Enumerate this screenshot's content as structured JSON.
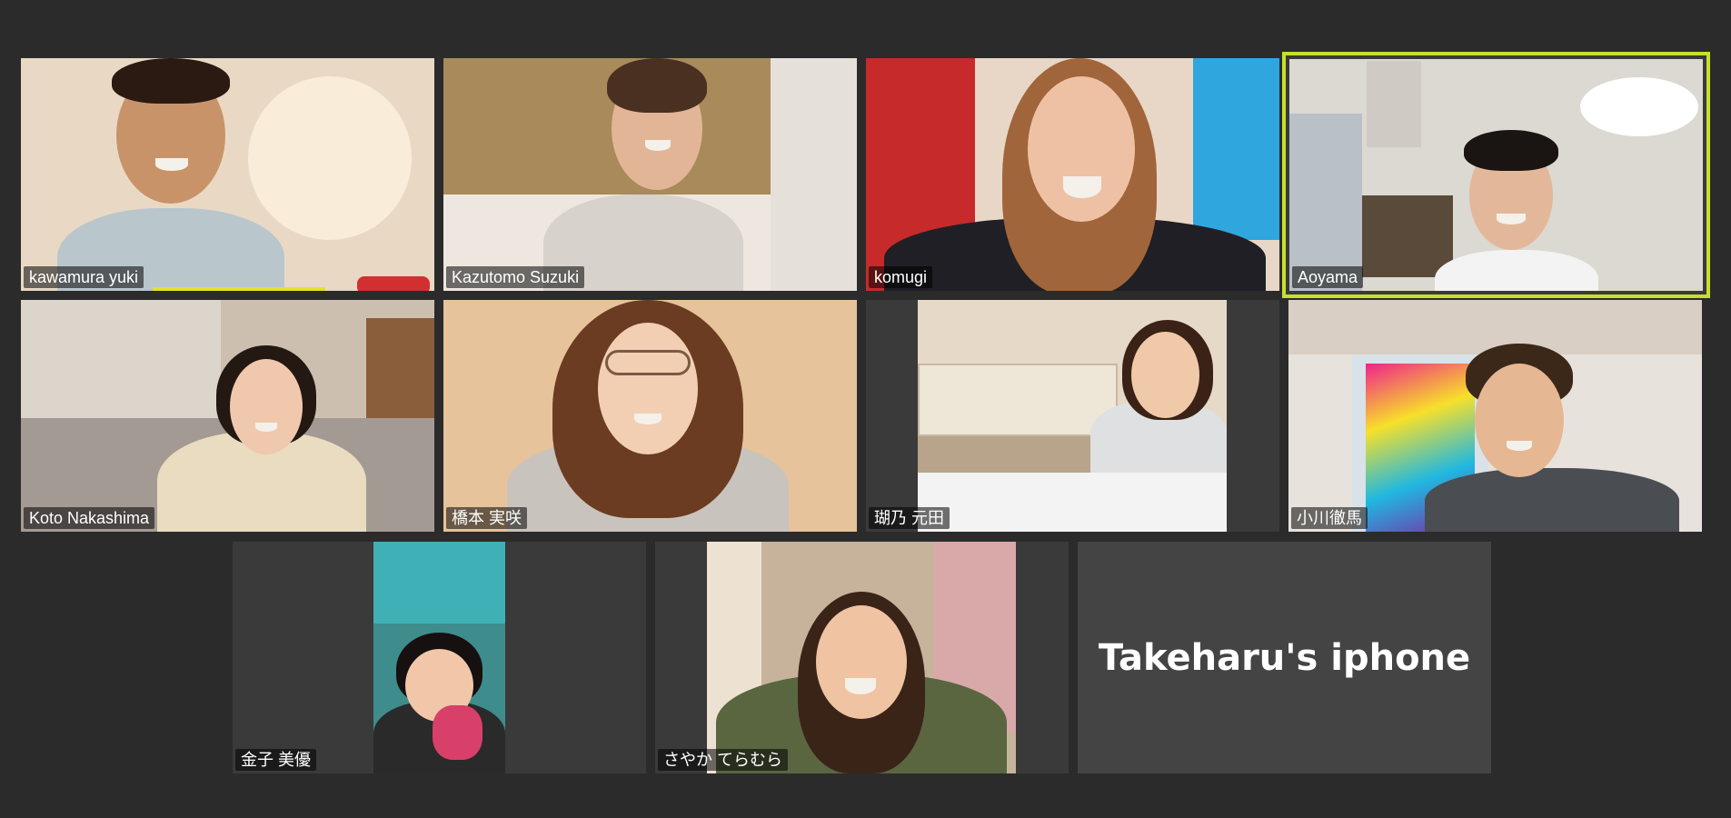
{
  "participants": [
    {
      "name": "kawamura yuki",
      "bg": "#e9d9c4",
      "skin": "#c9936a",
      "hair": "#2a1a12",
      "shirt": "#b9c6cc"
    },
    {
      "name": "Kazutomo Suzuki",
      "bg": "#a98a5a",
      "skin": "#e2b596",
      "hair": "#4a3020",
      "shirt": "#d8d2cc"
    },
    {
      "name": "komugi",
      "bg": "#c72a2a",
      "skin": "#efc1a4",
      "hair": "#a0653a",
      "shirt": "#1f1f25"
    },
    {
      "name": "Aoyama",
      "bg": "#dcd8d2",
      "skin": "#e3b89a",
      "hair": "#1a1412",
      "shirt": "#f3f3f3"
    },
    {
      "name": "Koto Nakashima",
      "bg": "#cdbfb0",
      "skin": "#f0c8ae",
      "hair": "#241812",
      "shirt": "#e9dcc0"
    },
    {
      "name": "橋本 実咲",
      "bg": "#e6c39a",
      "skin": "#f2cfb3",
      "hair": "#6b3c22",
      "shirt": "#c9c3bd"
    },
    {
      "name": "瑚乃 元田",
      "bg": "#e7d9c7",
      "skin": "#f0c9a9",
      "hair": "#3a2216",
      "shirt": "#dfe0e2"
    },
    {
      "name": "小川徹馬",
      "bg": "#e8e2dc",
      "skin": "#e6b793",
      "hair": "#3b2818",
      "shirt": "#4a4d52"
    },
    {
      "name": "金子 美優",
      "bg": "#3f8c8c",
      "skin": "#f2c6a8",
      "hair": "#161010",
      "shirt": "#2a2a2a"
    },
    {
      "name": "さやか てらむら",
      "bg": "#c7b39c",
      "skin": "#f0c3a2",
      "hair": "#3a2418",
      "shirt": "#5a6640"
    }
  ],
  "device_tile": {
    "name": "Takeharu's iphone"
  },
  "active_speaker": "Aoyama",
  "colors": {
    "background": "#2b2b2b",
    "tile": "#3a3a3a",
    "active_border": "#c8e02a"
  }
}
